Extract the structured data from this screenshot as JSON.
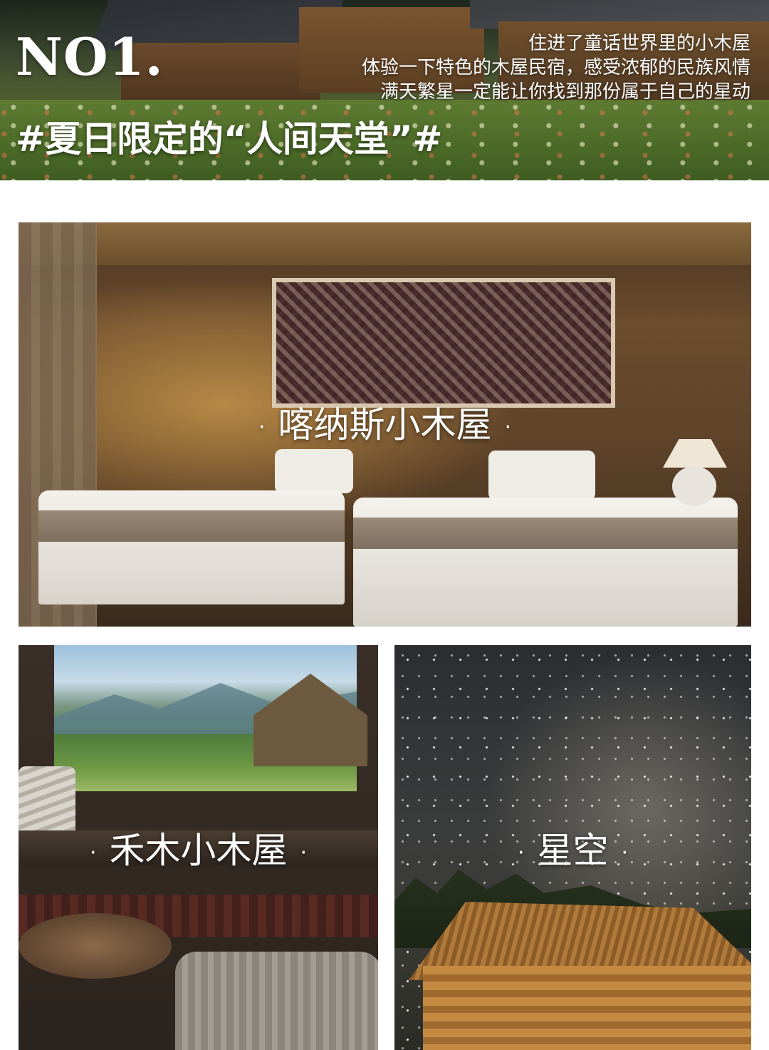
{
  "header": {
    "rank": "NO1.",
    "intro_lines": [
      "住进了童话世界里的小木屋",
      "体验一下特色的木屋民宿，感受浓郁的民族风情",
      "满天繁星一定能让你找到那份属于自己的星动"
    ],
    "tagline": "#夏日限定的“人间天堂”#"
  },
  "photos": {
    "bedroom": {
      "label": "喀纳斯小木屋"
    },
    "window_room": {
      "label": "禾木小木屋"
    },
    "stars": {
      "label": "星空"
    }
  },
  "decor": {
    "dot": "·"
  }
}
